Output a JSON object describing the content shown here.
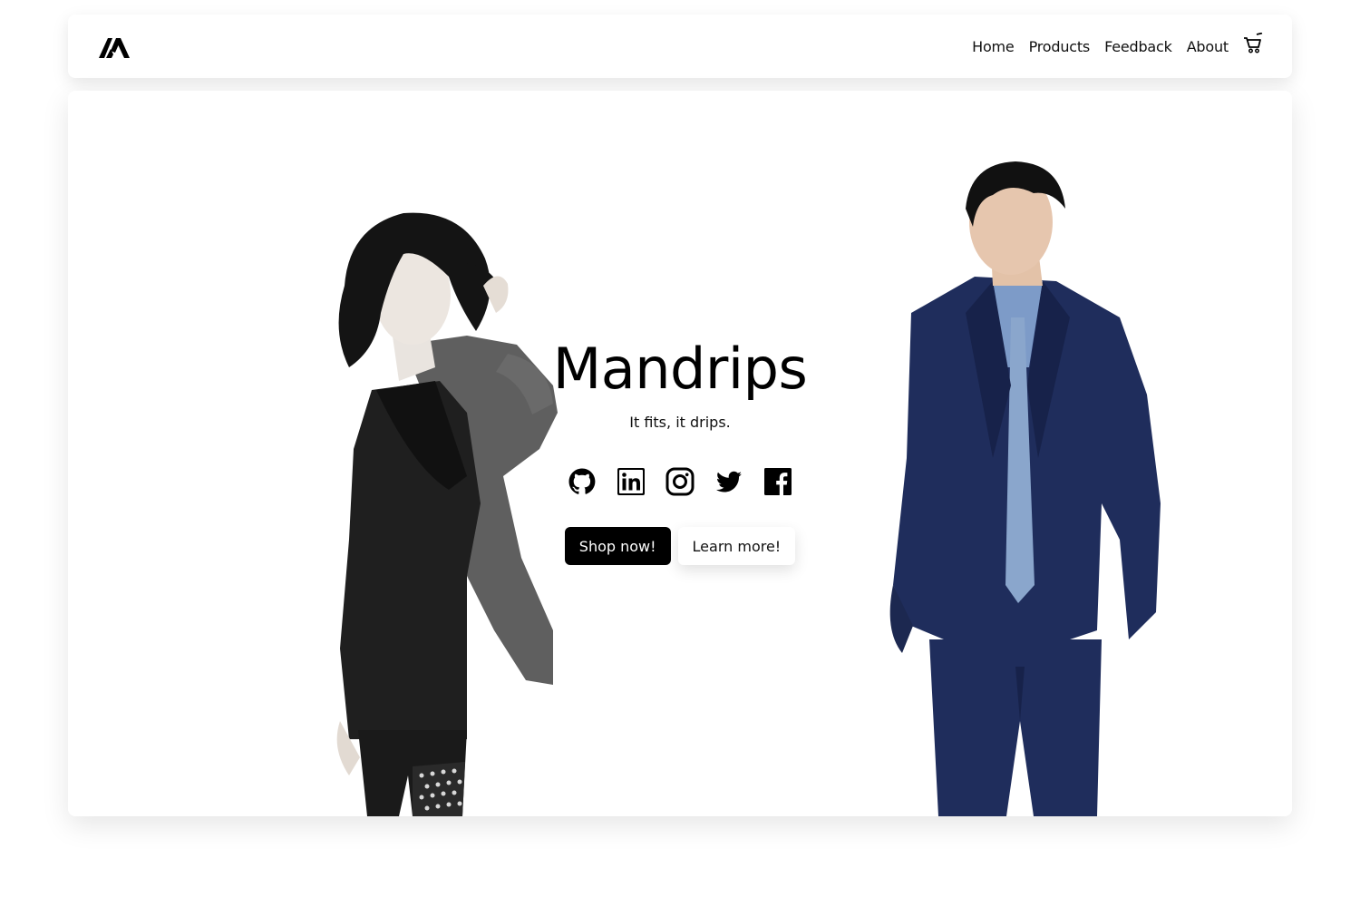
{
  "navbar": {
    "logo_icon": "mandrips-logo-icon",
    "links": [
      {
        "label": "Home"
      },
      {
        "label": "Products"
      },
      {
        "label": "Feedback"
      },
      {
        "label": "About"
      }
    ],
    "cart_icon": "shopping-cart-icon"
  },
  "hero": {
    "title": "Mandrips",
    "tagline": "It fits, it drips.",
    "socials": [
      "github-icon",
      "linkedin-icon",
      "instagram-icon",
      "twitter-icon",
      "facebook-icon"
    ],
    "primary_button": "Shop now!",
    "secondary_button": "Learn more!",
    "images": [
      "model-in-black-cardigan",
      "model-in-navy-suit"
    ]
  },
  "colors": {
    "primary": "#000000",
    "background": "#ffffff",
    "suit_navy": "#1f2d5c"
  }
}
